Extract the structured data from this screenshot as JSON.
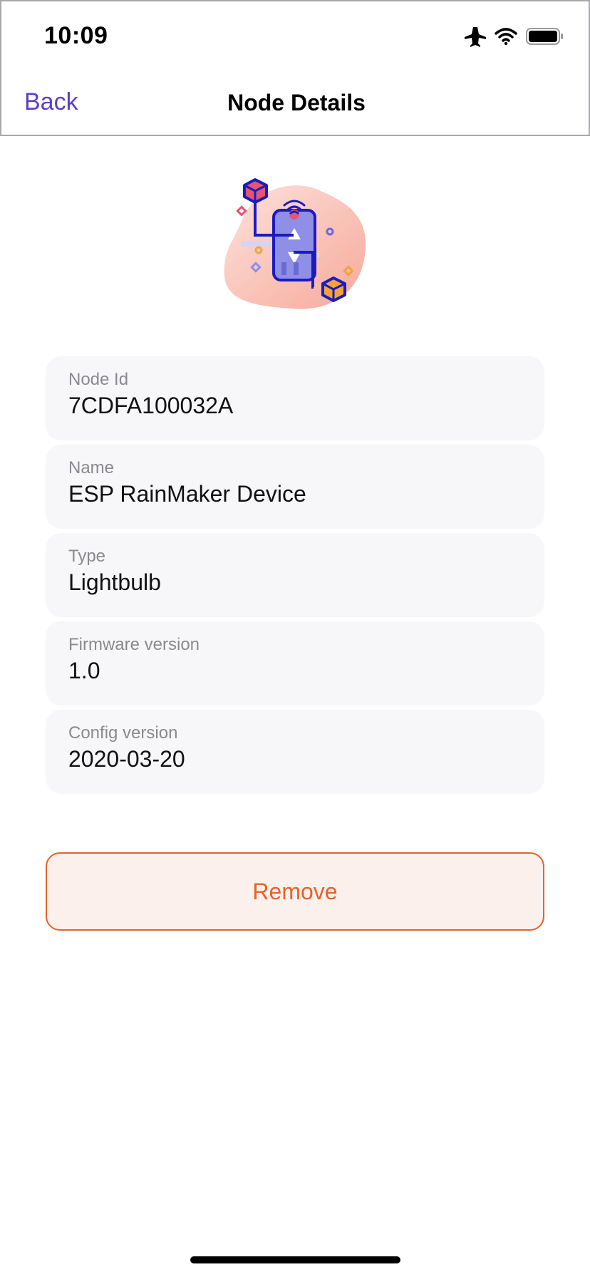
{
  "status_bar": {
    "time": "10:09",
    "icons": [
      "airplane-icon",
      "wifi-icon",
      "battery-icon"
    ]
  },
  "nav": {
    "back_label": "Back",
    "title": "Node Details"
  },
  "illustration": {
    "name": "node-illustration",
    "colors": {
      "blob": "#f7b7a9",
      "line": "#1b1bbf",
      "phone": "#8f8fe8",
      "accent_red": "#e4566e",
      "accent_orange": "#f2a33a"
    }
  },
  "details": [
    {
      "label": "Node Id",
      "value": "7CDFA100032A"
    },
    {
      "label": "Name",
      "value": "ESP RainMaker Device"
    },
    {
      "label": "Type",
      "value": "Lightbulb"
    },
    {
      "label": "Firmware version",
      "value": "1.0"
    },
    {
      "label": "Config version",
      "value": "2020-03-20"
    }
  ],
  "actions": {
    "remove_label": "Remove"
  },
  "colors": {
    "accent": "#5b3fc8",
    "danger": "#e5632a",
    "danger_bg": "#fcf0ec",
    "card_bg": "#f7f7fa",
    "label": "#8a8a8e"
  }
}
